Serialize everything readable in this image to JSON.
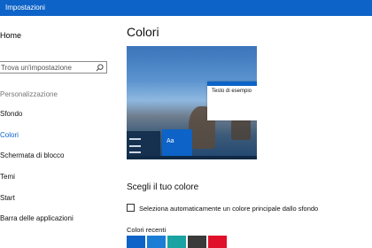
{
  "window": {
    "title": "Impostazioni",
    "accent": "#0d63c7"
  },
  "sidebar": {
    "home": "Home",
    "search_placeholder": "Trova un'impostazione",
    "search_icon": "search-icon",
    "section": "Personalizzazione",
    "items": [
      {
        "label": "Sfondo"
      },
      {
        "label": "Colori",
        "active": true
      },
      {
        "label": "Schermata di blocco"
      },
      {
        "label": "Temi"
      },
      {
        "label": "Start"
      },
      {
        "label": "Barra delle applicazioni"
      }
    ]
  },
  "main": {
    "title": "Colori",
    "preview": {
      "sample_text": "Testo di esempio",
      "tile_text": "Aa"
    },
    "section_title": "Scegli il tuo colore",
    "auto_color_label": "Seleziona automaticamente un colore principale dallo sfondo",
    "auto_color_checked": false,
    "recent_colors_label": "Colori recenti",
    "recent_colors": [
      "#0d63c7",
      "#1a7dd6",
      "#1aa3a3",
      "#3a3a3a",
      "#e0102a"
    ]
  }
}
